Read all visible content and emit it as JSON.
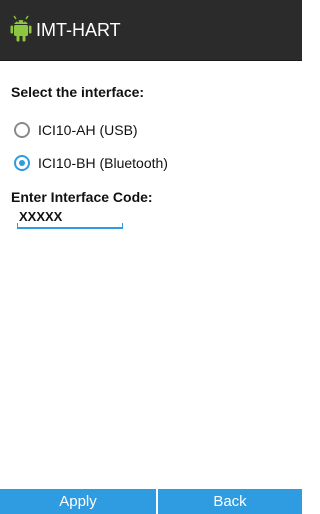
{
  "app": {
    "title": "IMT-HART",
    "icon": "android-icon",
    "accent_color": "#2f9be0",
    "titlebar_color": "#2b2b2b",
    "icon_color": "#8dc63f"
  },
  "interface_section": {
    "label": "Select the interface:",
    "options": [
      {
        "label": "ICI10-AH (USB)",
        "selected": false
      },
      {
        "label": "ICI10-BH (Bluetooth)",
        "selected": true
      }
    ]
  },
  "code_section": {
    "label": "Enter Interface Code:",
    "value": "XXXXX"
  },
  "buttons": {
    "apply_label": "Apply",
    "back_label": "Back"
  }
}
